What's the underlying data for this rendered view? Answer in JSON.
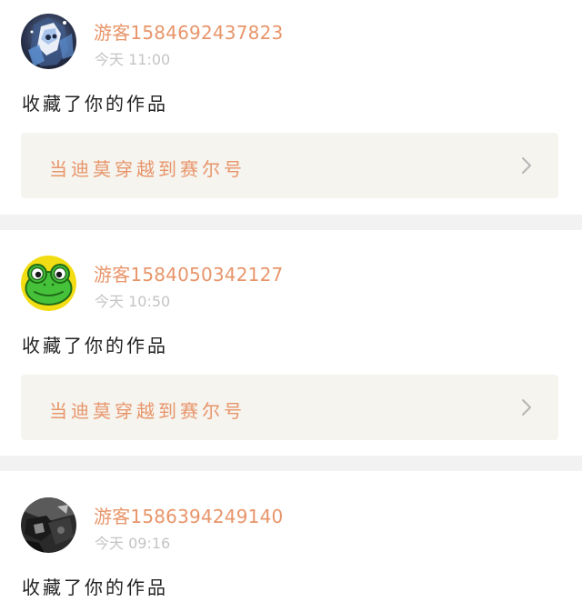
{
  "notifications": [
    {
      "username": "游客1584692437823",
      "time": "今天 11:00",
      "action": "收藏了你的作品",
      "work_title": "当迪莫穿越到赛尔号",
      "avatar": "anime-character-avatar"
    },
    {
      "username": "游客1584050342127",
      "time": "今天 10:50",
      "action": "收藏了你的作品",
      "work_title": "当迪莫穿越到赛尔号",
      "avatar": "frog-avatar"
    },
    {
      "username": "游客1586394249140",
      "time": "今天 09:16",
      "action": "收藏了你的作品",
      "avatar": "dark-photo-avatar"
    }
  ],
  "colors": {
    "username": "#e8956a",
    "work_title": "#e8956a",
    "time": "#c4c4c4",
    "action": "#222222",
    "work_card_bg": "#f5f4ef",
    "separator": "#f2f2f2"
  },
  "icons": {
    "chevron": "chevron-right-icon"
  }
}
